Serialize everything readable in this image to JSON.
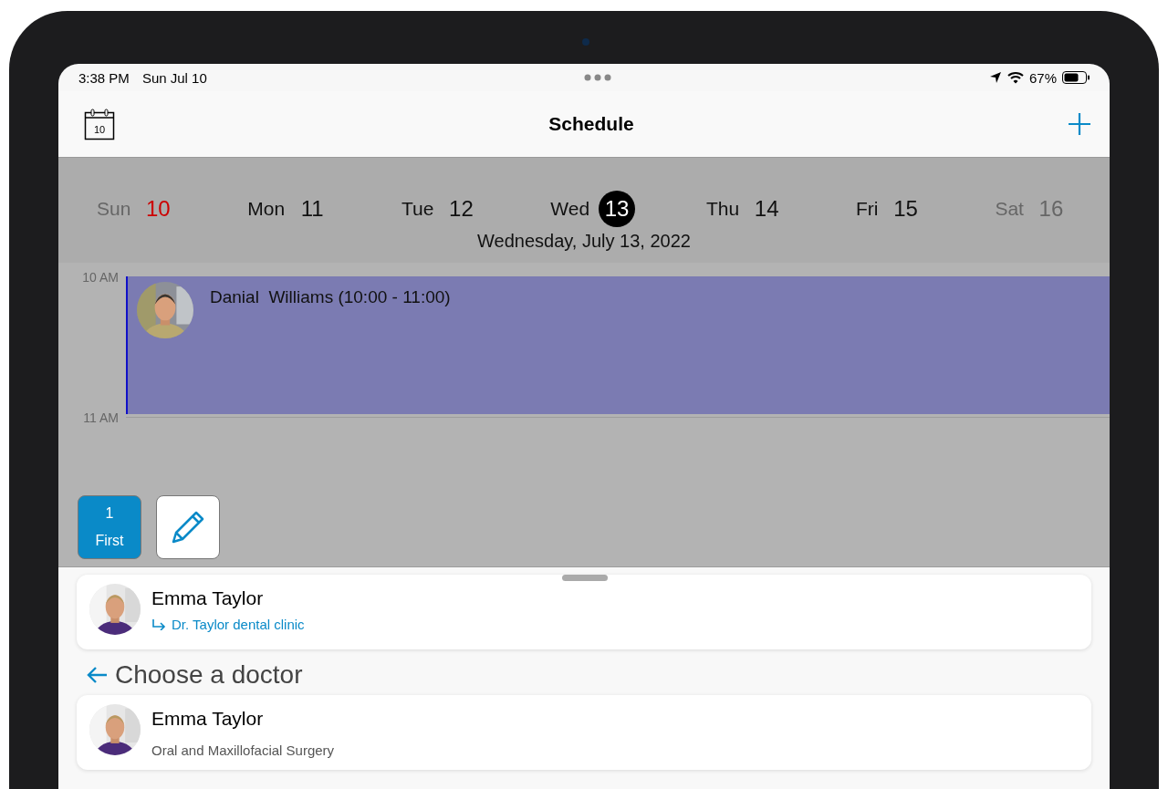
{
  "status_bar": {
    "time": "3:38 PM",
    "date": "Sun Jul 10",
    "battery": "67%"
  },
  "nav_bar": {
    "calendar_day": "10",
    "title": "Schedule"
  },
  "week": {
    "days": [
      {
        "name": "Sun",
        "number": "10",
        "weekend": true,
        "today": true,
        "selected": false
      },
      {
        "name": "Mon",
        "number": "11",
        "weekend": false,
        "today": false,
        "selected": false
      },
      {
        "name": "Tue",
        "number": "12",
        "weekend": false,
        "today": false,
        "selected": false
      },
      {
        "name": "Wed",
        "number": "13",
        "weekend": false,
        "today": false,
        "selected": true
      },
      {
        "name": "Thu",
        "number": "14",
        "weekend": false,
        "today": false,
        "selected": false
      },
      {
        "name": "Fri",
        "number": "15",
        "weekend": false,
        "today": false,
        "selected": false
      },
      {
        "name": "Sat",
        "number": "16",
        "weekend": true,
        "today": false,
        "selected": false
      }
    ],
    "date_label": "Wednesday, July 13, 2022"
  },
  "timeline": {
    "hours": [
      "10 AM",
      "11 AM"
    ],
    "events": [
      {
        "title": "Danial  Williams (10:00 - 11:00)",
        "color": "#7b7bb2"
      }
    ]
  },
  "actions": {
    "count": "1",
    "label": "First"
  },
  "selected_doctor": {
    "name": "Emma Taylor",
    "clinic": "Dr. Taylor dental clinic"
  },
  "heading": "Choose a doctor",
  "doctors": [
    {
      "name": "Emma Taylor",
      "specialty": "Oral and Maxillofacial Surgery"
    }
  ]
}
